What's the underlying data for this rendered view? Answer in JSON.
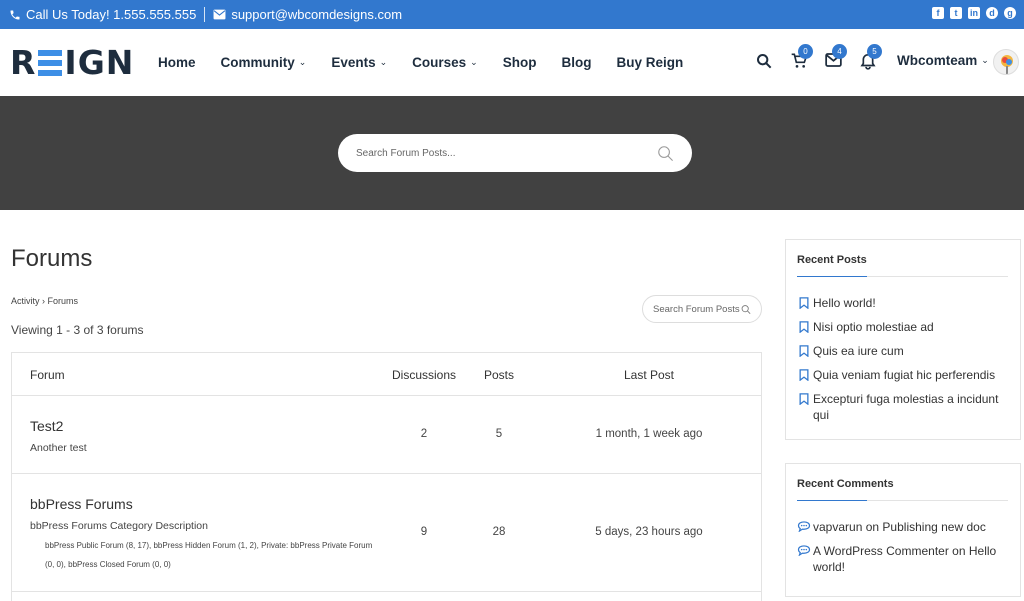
{
  "topbar": {
    "phone": "Call Us Today! 1.555.555.555",
    "email": "support@wbcomdesigns.com",
    "social": [
      "f",
      "t",
      "in",
      "d",
      "g"
    ]
  },
  "header": {
    "logo_text": "REIGN",
    "nav": [
      {
        "label": "Home",
        "dropdown": false
      },
      {
        "label": "Community",
        "dropdown": true
      },
      {
        "label": "Events",
        "dropdown": true
      },
      {
        "label": "Courses",
        "dropdown": true
      },
      {
        "label": "Shop",
        "dropdown": false
      },
      {
        "label": "Blog",
        "dropdown": false
      },
      {
        "label": "Buy Reign",
        "dropdown": false
      }
    ],
    "cart_count": "0",
    "messages_count": "4",
    "notifications_count": "5",
    "username": "Wbcomteam"
  },
  "hero": {
    "search_placeholder": "Search Forum Posts..."
  },
  "main": {
    "title": "Forums",
    "breadcrumb": "Activity › Forums",
    "viewing": "Viewing 1 - 3 of 3 forums",
    "side_search_placeholder": "Search Forum Posts",
    "table": {
      "headers": {
        "forum": "Forum",
        "discussions": "Discussions",
        "posts": "Posts",
        "last_post": "Last Post"
      },
      "rows": [
        {
          "name": "Test2",
          "description": "Another test",
          "discussions": "2",
          "posts": "5",
          "last_post": "1 month, 1 week ago",
          "subforums": ""
        },
        {
          "name": "bbPress Forums",
          "description": "bbPress Forums Category Description",
          "discussions": "9",
          "posts": "28",
          "last_post": "5 days, 23 hours ago",
          "subforums": "bbPress Public Forum (8, 17), bbPress Hidden Forum (1, 2), Private: bbPress Private Forum (0, 0), bbPress Closed Forum (0, 0)"
        }
      ]
    }
  },
  "sidebar": {
    "recent_posts": {
      "title": "Recent Posts",
      "items": [
        "Hello world!",
        "Nisi optio molestiae ad",
        "Quis ea iure cum",
        "Quia veniam fugiat hic perferendis",
        "Excepturi fuga molestias a incidunt qui"
      ]
    },
    "recent_comments": {
      "title": "Recent Comments",
      "items": [
        {
          "author": "vapvarun",
          "on": "on",
          "post": "Publishing new doc"
        },
        {
          "author": "A WordPress Commenter",
          "on": "on",
          "post": "Hello world!"
        }
      ]
    }
  },
  "colors": {
    "accent": "#3278ce",
    "logo_dark": "#1e2d3e",
    "logo_blue": "#3d8fe6",
    "hero_bg": "#414141"
  }
}
